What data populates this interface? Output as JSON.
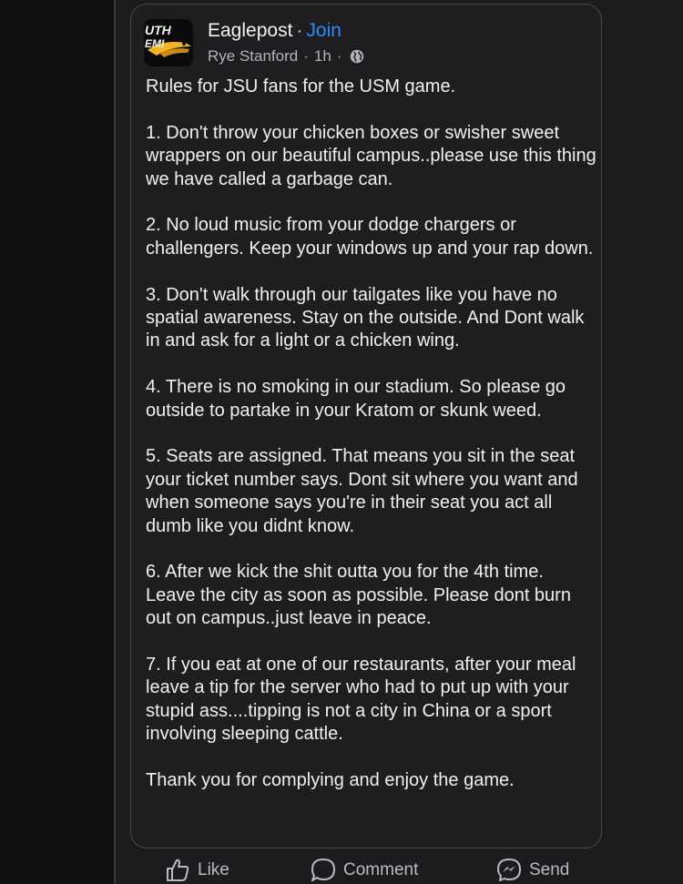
{
  "post": {
    "group_name": "Eaglepost",
    "separator": "·",
    "join_label": "Join",
    "author": "Rye Stanford",
    "time": "1h",
    "logo_text_top": "UTH",
    "logo_text_bottom": "EMI",
    "paragraphs": [
      "Rules for JSU fans for the USM game.",
      "1. Don't throw your chicken boxes or swisher sweet wrappers on our beautiful campus..please use this thing we have called a garbage can.",
      "2. No loud music from your dodge chargers or challengers. Keep your windows up and your rap down.",
      "3. Don't walk through our tailgates like you have no spatial awareness. Stay on the outside. And Dont walk in and ask for a light or a chicken wing.",
      "4. There is no smoking in our stadium. So please go outside to partake in your Kratom or skunk weed.",
      "5. Seats are assigned. That means you sit in the seat your ticket number says. Dont sit where you want and when someone says you're in their seat you act all dumb like you didnt know.",
      "6. After we kick the shit outta you for the 4th time. Leave the city as soon as possible. Please dont burn out on campus..just leave in peace.",
      "7. If you eat at one of our restaurants, after your meal leave a tip for the server who had to put up with your stupid ass....tipping is not a city in China or a sport involving sleeping cattle.",
      "Thank you for complying and enjoy the game."
    ]
  },
  "actions": {
    "like": "Like",
    "comment": "Comment",
    "send": "Send"
  },
  "icons": {
    "avatar": "group-logo",
    "privacy": "globe-icon",
    "like": "thumbs-up-icon",
    "comment": "comment-bubble-icon",
    "send": "messenger-icon"
  },
  "colors": {
    "background": "#1c1c1e",
    "card": "#1e1e20",
    "text": "#f0f0f0",
    "secondary_text": "#b0b3b8",
    "join": "#2e89ff",
    "logo_gold": "#f2b51d"
  }
}
